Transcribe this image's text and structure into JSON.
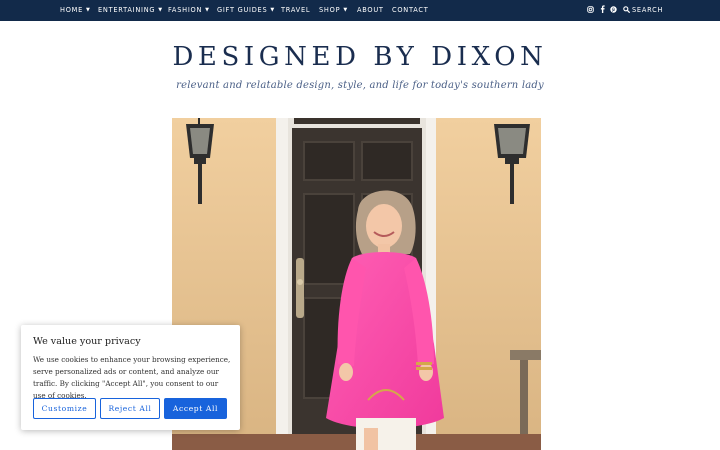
{
  "nav": {
    "items": [
      {
        "label": "HOME",
        "has_dropdown": true
      },
      {
        "label": "ENTERTAINING",
        "has_dropdown": true
      },
      {
        "label": "FASHION",
        "has_dropdown": true
      },
      {
        "label": "GIFT GUIDES",
        "has_dropdown": true
      },
      {
        "label": "TRAVEL",
        "has_dropdown": false
      },
      {
        "label": "SHOP",
        "has_dropdown": true
      },
      {
        "label": "ABOUT",
        "has_dropdown": false
      },
      {
        "label": "CONTACT",
        "has_dropdown": false
      }
    ],
    "social_icons": [
      "instagram-icon",
      "facebook-icon",
      "pinterest-icon"
    ],
    "search_label": "SEARCH",
    "bar_color": "#122a4a"
  },
  "header": {
    "title": "DESIGNED BY DIXON",
    "tagline": "relevant and relatable design, style, and life for today's southern lady"
  },
  "hero": {
    "subject": "woman in pink tunic dress standing in front of a dark door between two wall lanterns"
  },
  "cookie_banner": {
    "title": "We value your privacy",
    "text": "We use cookies to enhance your browsing experience, serve personalized ads or content, and analyze our traffic. By clicking \"Accept All\", you consent to our use of cookies.",
    "buttons": {
      "customize": "Customize",
      "reject": "Reject All",
      "accept": "Accept All"
    },
    "accent_color": "#1863dc"
  }
}
